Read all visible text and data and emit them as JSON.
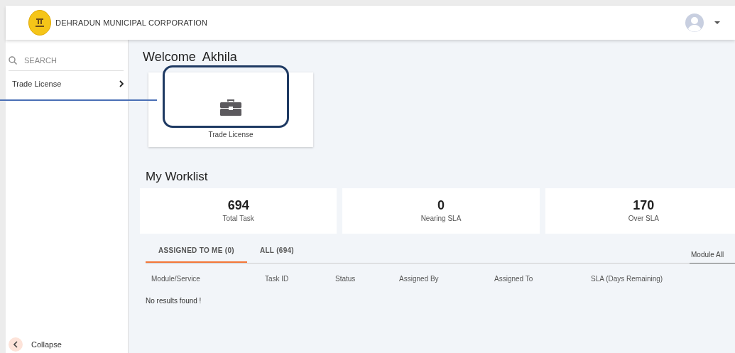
{
  "header": {
    "title": "DEHRADUN MUNICIPAL CORPORATION"
  },
  "sidebar": {
    "search": {
      "placeholder": "SEARCH"
    },
    "items": [
      {
        "label": "Trade License",
        "selected": false
      }
    ],
    "collapse": "Collapse"
  },
  "welcome": {
    "greeting": "Welcome",
    "user": "Akhila"
  },
  "modules": [
    {
      "label": "Trade License",
      "highlighted": true
    }
  ],
  "worklist": {
    "title": "My Worklist",
    "stats": [
      {
        "value": "694",
        "label": "Total Task"
      },
      {
        "value": "0",
        "label": "Nearing SLA"
      },
      {
        "value": "170",
        "label": "Over SLA"
      }
    ],
    "tabs": [
      {
        "label": "ASSIGNED TO ME (0)",
        "selected": true
      },
      {
        "label": "ALL (694)",
        "selected": false
      }
    ],
    "filter": {
      "value": "Module All"
    },
    "columns": [
      "Module/Service",
      "Task ID",
      "Status",
      "Assigned By",
      "Assigned To",
      "SLA (Days Remaining)"
    ],
    "empty": "No results found !"
  }
}
